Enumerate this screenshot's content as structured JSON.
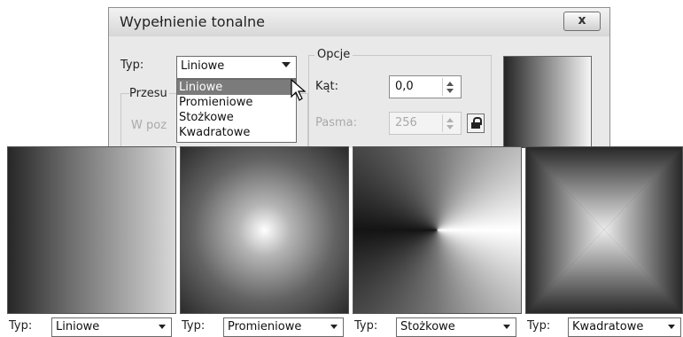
{
  "dialog": {
    "title": "Wypełnienie tonalne",
    "close_glyph": "x",
    "type_label": "Typ:",
    "type_value": "Liniowe",
    "offset_group_label": "Przesu",
    "center_label": "W poz",
    "options_label": "Opcje",
    "angle_label": "Kąt:",
    "angle_value": "0,0",
    "steps_label": "Pasma:",
    "steps_value": "256",
    "dropdown_options": [
      "Liniowe",
      "Promieniowe",
      "Stożkowe",
      "Kwadratowe"
    ],
    "dropdown_selected": "Liniowe"
  },
  "panels": [
    {
      "type_label": "Typ:",
      "type_value": "Liniowe"
    },
    {
      "type_label": "Typ:",
      "type_value": "Promieniowe"
    },
    {
      "type_label": "Typ:",
      "type_value": "Stożkowe"
    },
    {
      "type_label": "Typ:",
      "type_value": "Kwadratowe"
    }
  ],
  "icons": {
    "close": "close-icon",
    "lock": "lock-icon",
    "cursor": "mouse-cursor-icon",
    "dropdown_arrow": "chevron-down-icon"
  }
}
